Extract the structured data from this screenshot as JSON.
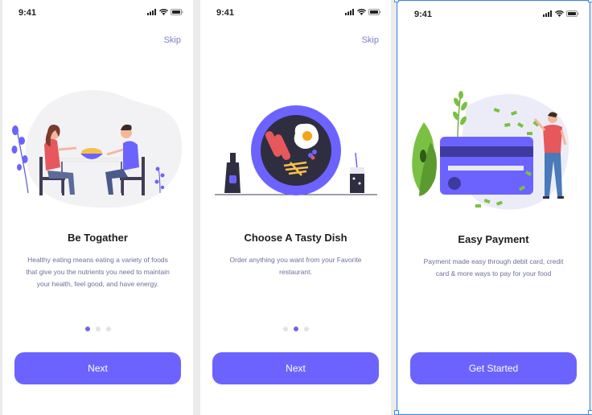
{
  "status": {
    "time": "9:41"
  },
  "screens": [
    {
      "skip": "Skip",
      "title": "Be Togather",
      "description": "Healthy eating means eating a variety of foods that give you the nutrients you need to maintain your health, feel good, and have energy.",
      "button": "Next",
      "active_dot": 0
    },
    {
      "skip": "Skip",
      "title": "Choose A Tasty Dish",
      "description": "Order anything you want from your Favorite restaurant.",
      "button": "Next",
      "active_dot": 1
    },
    {
      "title": "Easy Payment",
      "description": "Payment made easy through debit card, credit card  & more ways to pay for your food",
      "button": "Get Started"
    }
  ],
  "colors": {
    "primary": "#6c63ff",
    "text_muted": "#6b6f9a",
    "dot_inactive": "#e2e2ea"
  },
  "icons": [
    "signal-icon",
    "wifi-icon",
    "battery-icon"
  ]
}
